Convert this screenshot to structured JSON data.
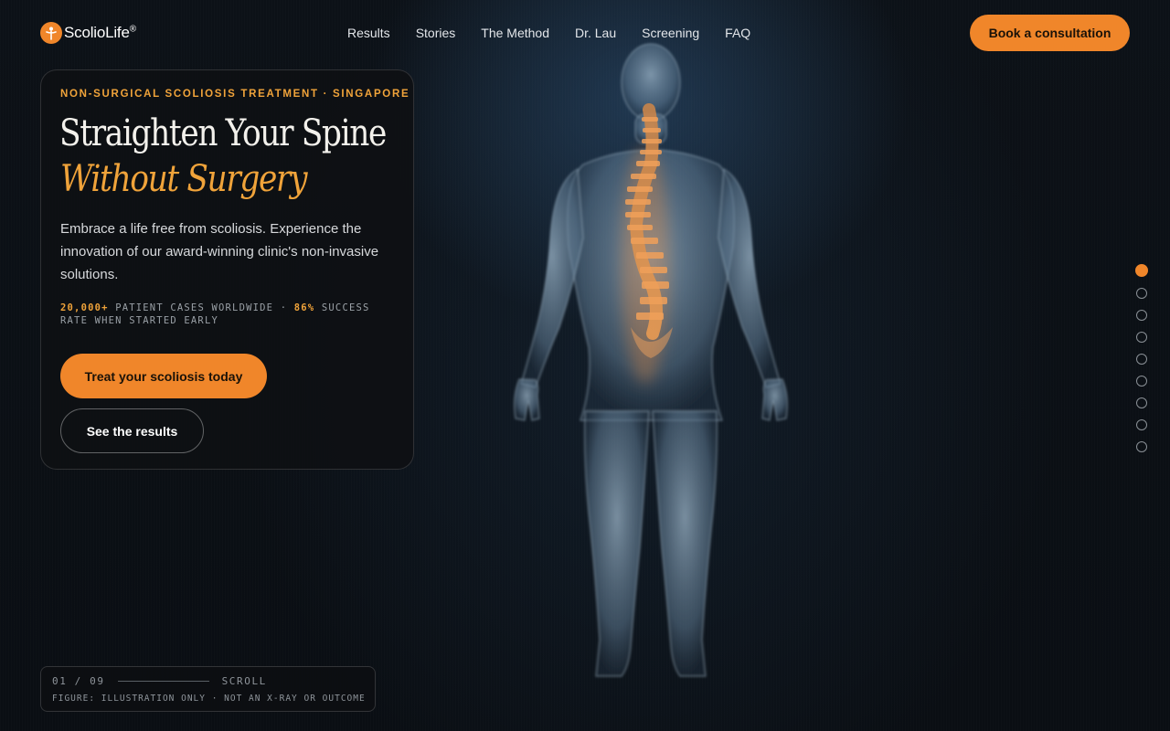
{
  "brand": {
    "name": "ScolioLife",
    "mark": "®"
  },
  "nav": {
    "items": [
      "Results",
      "Stories",
      "The Method",
      "Dr. Lau",
      "Screening",
      "FAQ"
    ],
    "cta": "Book a consultation"
  },
  "hero": {
    "eyebrow": "NON-SURGICAL SCOLIOSIS TREATMENT · SINGAPORE",
    "title_line1": "Straighten Your Spine",
    "title_line2": "Without Surgery",
    "lede": "Embrace a life free from scoliosis. Experience the innovation of our award-winning clinic's non-invasive solutions.",
    "stats": {
      "cases_value": "20,000+",
      "cases_label": "PATIENT CASES WORLDWIDE ·",
      "success_value": "86%",
      "success_label": "SUCCESS RATE WHEN STARTED EARLY"
    },
    "primary_cta": "Treat your scoliosis today",
    "secondary_cta": "See the results"
  },
  "figure": {
    "icon": "human-spine-illustration"
  },
  "pager": {
    "total": 9,
    "active_index": 0
  },
  "footer": {
    "counter": "01 / 09",
    "scroll_label": "SCROLL",
    "note": "FIGURE: ILLUSTRATION ONLY · NOT AN X-RAY OR OUTCOME"
  },
  "colors": {
    "accent": "#f0862a",
    "accent_text": "#f0a33a",
    "background": "#0b0f14"
  }
}
